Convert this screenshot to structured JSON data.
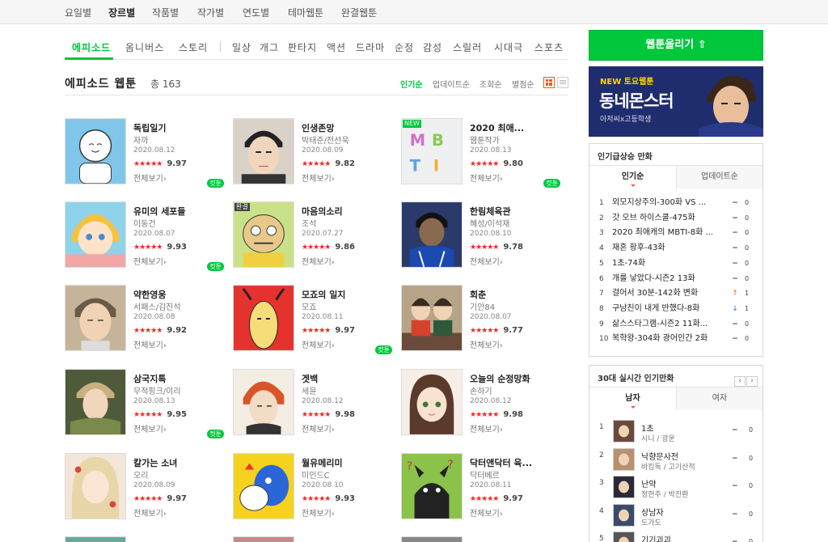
{
  "topnav": {
    "items": [
      "요일별",
      "장르별",
      "작품별",
      "작가별",
      "연도별",
      "테마웹툰",
      "완결웹툰"
    ]
  },
  "genres": [
    "에피소드",
    "옴니버스",
    "스토리",
    "일상",
    "개그",
    "판타지",
    "액션",
    "드라마",
    "순정",
    "감성",
    "스릴러",
    "시대극",
    "스포츠"
  ],
  "title": {
    "main": "에피소드 웹툰",
    "count": "총 163"
  },
  "sort": [
    "인기순",
    "업데이트순",
    "조회순",
    "별점순"
  ],
  "cards": [
    {
      "title": "독립일기",
      "author": "자까",
      "date": "2020.08.12",
      "stars": "★★★★★",
      "score": "9.97",
      "link": "전체보기›",
      "cut": "컷툰",
      "tag": ""
    },
    {
      "title": "인생존망",
      "author": "박태준/전선욱",
      "date": "2020.08.09",
      "stars": "★★★★★",
      "score": "9.82",
      "link": "전체보기›",
      "cut": "",
      "tag": ""
    },
    {
      "title": "2020 최애...",
      "author": "웹툰작가",
      "date": "2020.08.13",
      "stars": "★★★★★",
      "score": "9.80",
      "link": "전체보기›",
      "cut": "컷툰",
      "tag": "NEW"
    },
    {
      "title": "유미의 세포들",
      "author": "이동건",
      "date": "2020.08.07",
      "stars": "★★★★★",
      "score": "9.93",
      "link": "전체보기›",
      "cut": "컷툰",
      "tag": ""
    },
    {
      "title": "마음의소리",
      "author": "조석",
      "date": "2020.07.27",
      "stars": "★★★★★",
      "score": "9.86",
      "link": "전체보기›",
      "cut": "",
      "tag": "완결"
    },
    {
      "title": "한림체육관",
      "author": "혜성/이석재",
      "date": "2020.08.10",
      "stars": "★★★★★",
      "score": "9.78",
      "link": "전체보기›",
      "cut": "",
      "tag": ""
    },
    {
      "title": "약한영웅",
      "author": "서패스/김진석",
      "date": "2020.08.08",
      "stars": "★★★★★",
      "score": "9.92",
      "link": "전체보기›",
      "cut": "",
      "tag": ""
    },
    {
      "title": "모죠의 일지",
      "author": "모죠",
      "date": "2020.08.11",
      "stars": "★★★★★",
      "score": "9.97",
      "link": "전체보기›",
      "cut": "컷툰",
      "tag": ""
    },
    {
      "title": "회춘",
      "author": "기안84",
      "date": "2020.08.07",
      "stars": "★★★★★",
      "score": "9.77",
      "link": "전체보기›",
      "cut": "",
      "tag": ""
    },
    {
      "title": "삼국지톡",
      "author": "무적핑크/이리",
      "date": "2020.08.13",
      "stars": "★★★★★",
      "score": "9.95",
      "link": "전체보기›",
      "cut": "컷툰",
      "tag": ""
    },
    {
      "title": "겟백",
      "author": "세윤",
      "date": "2020.08.12",
      "stars": "★★★★★",
      "score": "9.98",
      "link": "전체보기›",
      "cut": "",
      "tag": ""
    },
    {
      "title": "오늘의 순정망화",
      "author": "손하기",
      "date": "2020.08.12",
      "stars": "★★★★★",
      "score": "9.98",
      "link": "전체보기›",
      "cut": "",
      "tag": ""
    },
    {
      "title": "칼가는 소녀",
      "author": "오리",
      "date": "2020.08.09",
      "stars": "★★★★★",
      "score": "9.97",
      "link": "전체보기›",
      "cut": "",
      "tag": ""
    },
    {
      "title": "월유메리미",
      "author": "미인드C",
      "date": "2020.08.10",
      "stars": "★★★★★",
      "score": "9.93",
      "link": "전체보기›",
      "cut": "",
      "tag": ""
    },
    {
      "title": "닥터앤닥터 육...",
      "author": "닥터베르",
      "date": "2020.08.11",
      "stars": "★★★★★",
      "score": "9.97",
      "link": "전체보기›",
      "cut": "",
      "tag": ""
    }
  ],
  "colors": {
    "accent": "#00c73c",
    "star": "#ff2222",
    "up": "#ff5500",
    "down": "#2a6fe0"
  },
  "upload": {
    "label": "웹툰올리기 ⇧"
  },
  "banner": {
    "kicker": "NEW 토요웹툰",
    "title": "동네몬스터",
    "sub": "아저씨x고등학생"
  },
  "rising": {
    "heading": "인기급상승 만화",
    "tabs": [
      "인기순",
      "업데이트순"
    ],
    "rows": [
      {
        "rank": "1",
        "title": "외모지상주의-300화 VS ...",
        "change": "−",
        "value": "0",
        "dir": "flat"
      },
      {
        "rank": "2",
        "title": "갓 오브 하이스쿨-475화",
        "change": "−",
        "value": "0",
        "dir": "flat"
      },
      {
        "rank": "3",
        "title": "2020 최애캐의 MBTI-8화 ...",
        "change": "−",
        "value": "0",
        "dir": "flat"
      },
      {
        "rank": "4",
        "title": "재혼 황후-43화",
        "change": "−",
        "value": "0",
        "dir": "flat"
      },
      {
        "rank": "5",
        "title": "1초-74화",
        "change": "−",
        "value": "0",
        "dir": "flat"
      },
      {
        "rank": "6",
        "title": "개를 낳았다-시즌2 13화",
        "change": "−",
        "value": "0",
        "dir": "flat"
      },
      {
        "rank": "7",
        "title": "걸어서 30분-142화 변화",
        "change": "↑",
        "value": "1",
        "dir": "up"
      },
      {
        "rank": "8",
        "title": "구남친이 내게 반했다-8화",
        "change": "↓",
        "value": "1",
        "dir": "down"
      },
      {
        "rank": "9",
        "title": "삶스스타그램-시즌2 11화...",
        "change": "−",
        "value": "0",
        "dir": "flat"
      },
      {
        "rank": "10",
        "title": "복학왕-304화 광어인간 2화",
        "change": "−",
        "value": "0",
        "dir": "flat"
      }
    ]
  },
  "realtime": {
    "heading": "30대 실시간 인기만화",
    "prev": "‹",
    "next": "›",
    "tabs": [
      "남자",
      "여자"
    ],
    "rows": [
      {
        "rank": "1",
        "title": "1초",
        "author": "시니 / 광운",
        "change": "−",
        "value": "0"
      },
      {
        "rank": "2",
        "title": "낙향문사전",
        "author": "바킹독 / 고기산적",
        "change": "−",
        "value": "0"
      },
      {
        "rank": "3",
        "title": "난약",
        "author": "정현주 / 박진환",
        "change": "−",
        "value": "0"
      },
      {
        "rank": "4",
        "title": "상남자",
        "author": "도가도",
        "change": "−",
        "value": "0"
      },
      {
        "rank": "5",
        "title": "기기괴괴",
        "author": "",
        "change": "−",
        "value": "0"
      }
    ]
  }
}
